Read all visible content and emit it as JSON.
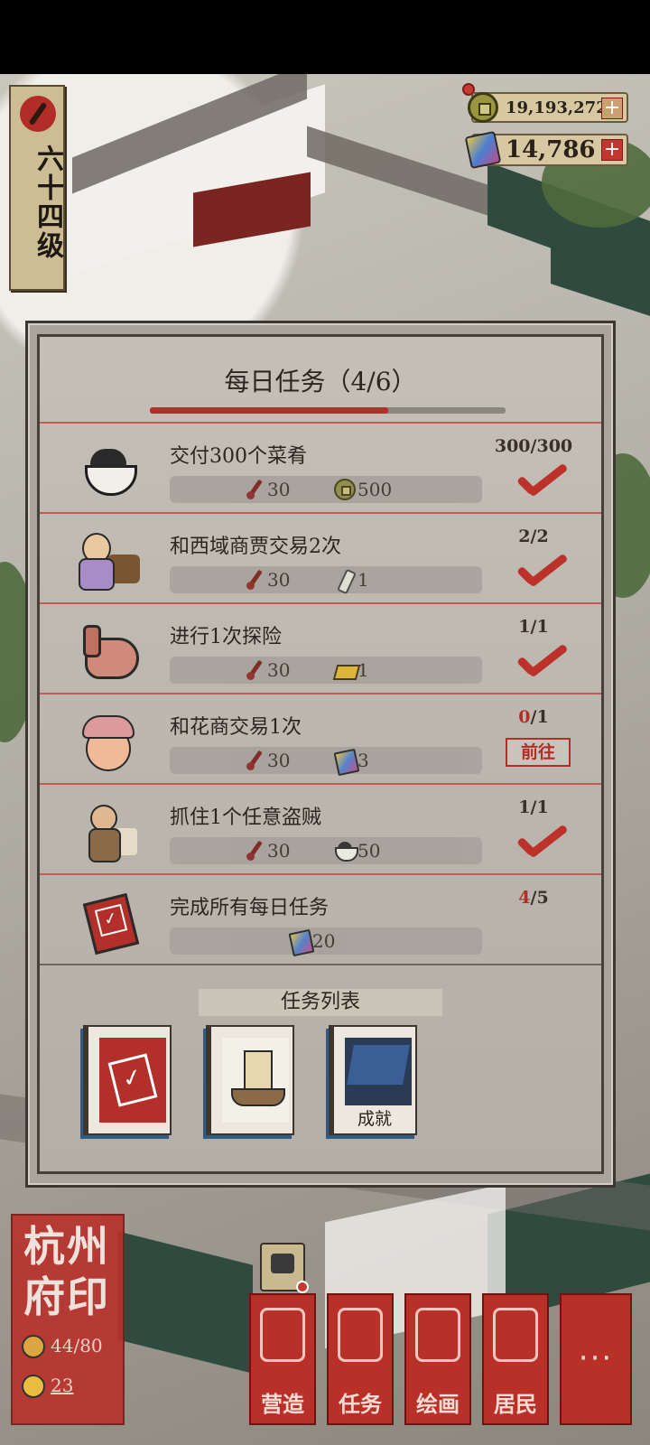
{
  "player": {
    "level_label": "六十四级"
  },
  "currencies": {
    "coins": "19,193,272",
    "gems": "14,786",
    "plus": "+"
  },
  "daily_tasks": {
    "title": "每日任务（4/6）",
    "progress_fraction": 0.67,
    "items": [
      {
        "icon": "bowl-icon",
        "title": "交付300个菜肴",
        "rewards": [
          {
            "icon": "brush-icon",
            "amount": "30"
          },
          {
            "icon": "coin-icon",
            "amount": "500"
          }
        ],
        "count_done": "300",
        "count_sep_total": "/300",
        "status": "done"
      },
      {
        "icon": "merchant-icon",
        "title": "和西域商贾交易2次",
        "rewards": [
          {
            "icon": "brush-icon",
            "amount": "30"
          },
          {
            "icon": "scroll-icon",
            "amount": "1"
          }
        ],
        "count_done": "2",
        "count_sep_total": "/2",
        "status": "done"
      },
      {
        "icon": "pouch-icon",
        "title": "进行1次探险",
        "rewards": [
          {
            "icon": "brush-icon",
            "amount": "30"
          },
          {
            "icon": "gold-ingot-icon",
            "amount": "1"
          }
        ],
        "count_done": "1",
        "count_sep_total": "/1",
        "status": "done"
      },
      {
        "icon": "flower-merchant-icon",
        "title": "和花商交易1次",
        "rewards": [
          {
            "icon": "brush-icon",
            "amount": "30"
          },
          {
            "icon": "gem-icon",
            "amount": "3"
          }
        ],
        "count_done": "0",
        "count_sep_total": "/1",
        "status": "go",
        "go_label": "前往"
      },
      {
        "icon": "thief-icon",
        "title": "抓住1个任意盗贼",
        "rewards": [
          {
            "icon": "brush-icon",
            "amount": "30"
          },
          {
            "icon": "bowl-icon",
            "amount": "50"
          }
        ],
        "count_done": "1",
        "count_sep_total": "/1",
        "status": "done"
      },
      {
        "icon": "task-book-icon",
        "title": "完成所有每日任务",
        "rewards": [
          {
            "icon": "gem-icon",
            "amount": "20"
          }
        ],
        "count_done": "4",
        "count_sep_total": "/5",
        "status": "progress"
      }
    ]
  },
  "task_list": {
    "header": "任务列表",
    "tabs": [
      {
        "name": "daily-tasks",
        "icon": "task-book-icon",
        "label": ""
      },
      {
        "name": "voyage-tasks",
        "icon": "boat-icon",
        "label": ""
      },
      {
        "name": "achievements",
        "icon": "achievement-icon",
        "label": "成就"
      }
    ]
  },
  "prefecture_seal": {
    "title": "杭州府印",
    "residents": "44/80",
    "other": "23"
  },
  "bottom_nav": [
    {
      "name": "build",
      "icon": "build-icon",
      "label": "营造"
    },
    {
      "name": "tasks",
      "icon": "tasks-icon",
      "label": "任务"
    },
    {
      "name": "paint",
      "icon": "painting-icon",
      "label": "绘画"
    },
    {
      "name": "residents",
      "icon": "residents-icon",
      "label": "居民"
    },
    {
      "name": "more",
      "icon": "more-icon",
      "label": "···"
    }
  ],
  "colors": {
    "accent_red": "#b42e29",
    "panel_bg": "#bbb7af",
    "ink": "#2c2620"
  }
}
